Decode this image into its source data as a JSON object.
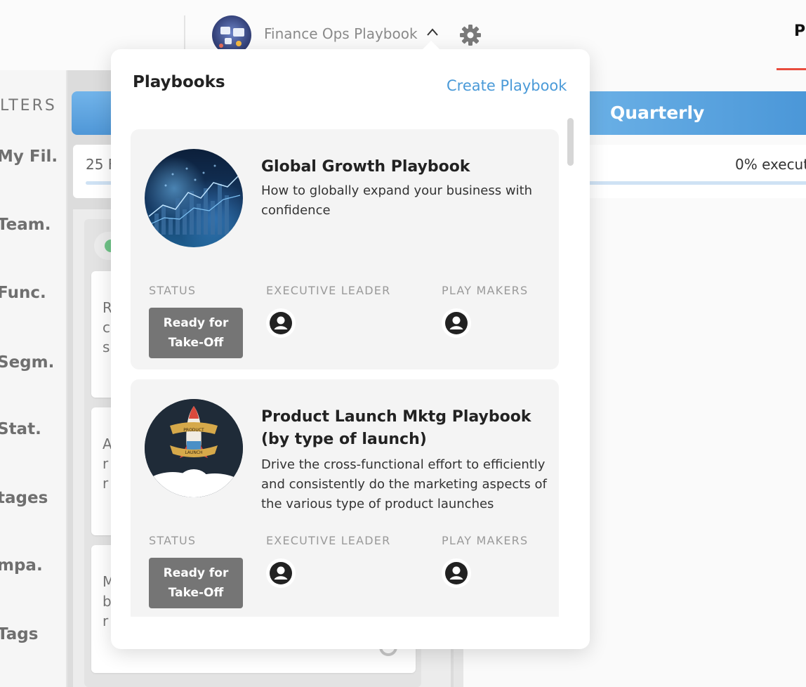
{
  "header": {
    "playbook_title": "Finance Ops Playbook",
    "right_tab_label": "P"
  },
  "filters": {
    "title": "LTERS",
    "items": [
      "My Fil.",
      "Team.",
      "Func.",
      "Segm.",
      "Stat.",
      "tages",
      "mpa.",
      "Tags"
    ]
  },
  "board": {
    "left_summary_text": "25 F",
    "left_card_fragments": [
      [
        "R",
        "c",
        "s"
      ],
      [
        "A",
        "r",
        "r"
      ],
      [
        "M",
        "b",
        "r"
      ]
    ],
    "quarterly_label": "Quarterly",
    "quarterly_exec_text": "0% execut"
  },
  "popover": {
    "title": "Playbooks",
    "create_label": "Create Playbook",
    "column_labels": {
      "status": "STATUS",
      "executive_leader": "EXECUTIVE LEADER",
      "play_makers": "PLAY MAKERS"
    },
    "playbooks": [
      {
        "name": "Global Growth Playbook",
        "description": "How to globally expand your business with confidence",
        "status_line1": "Ready for",
        "status_line2": "Take-Off"
      },
      {
        "name": "Product Launch Mktg Playbook (by type of launch)",
        "description": "Drive the cross-functional effort to efficiently and consistently do the marketing aspects of the various type of product launches",
        "status_line1": "Ready for",
        "status_line2": "Take-Off",
        "banner_top": "PRODUCT",
        "banner_bottom": "LAUNCH"
      }
    ]
  },
  "colors": {
    "accent_blue": "#4a9ad8",
    "status_grey": "#757575",
    "tab_underline": "#e84c3d"
  },
  "icons": {
    "settings": "gear-icon",
    "collapse": "chevron-up-icon",
    "user": "user-circle-icon"
  }
}
